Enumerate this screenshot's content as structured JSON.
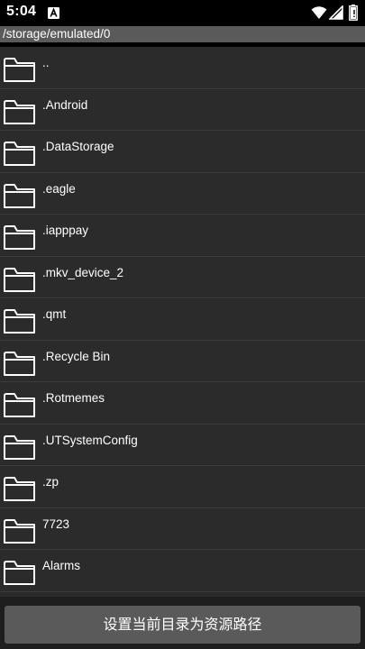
{
  "status_bar": {
    "time": "5:04",
    "notification_icon": "a-letter-icon",
    "wifi_icon": "wifi-icon",
    "signal_icon": "signal-icon",
    "battery_icon": "battery-icon"
  },
  "path_bar": {
    "path": "/storage/emulated/0"
  },
  "file_list": {
    "items": [
      {
        "name": "..",
        "icon": "folder-icon"
      },
      {
        "name": ".Android",
        "icon": "folder-icon"
      },
      {
        "name": ".DataStorage",
        "icon": "folder-icon"
      },
      {
        "name": ".eagle",
        "icon": "folder-icon"
      },
      {
        "name": ".iapppay",
        "icon": "folder-icon"
      },
      {
        "name": ".mkv_device_2",
        "icon": "folder-icon"
      },
      {
        "name": ".qmt",
        "icon": "folder-icon"
      },
      {
        "name": ".Recycle Bin",
        "icon": "folder-icon"
      },
      {
        "name": ".Rotmemes",
        "icon": "folder-icon"
      },
      {
        "name": ".UTSystemConfig",
        "icon": "folder-icon"
      },
      {
        "name": ".zp",
        "icon": "folder-icon"
      },
      {
        "name": "7723",
        "icon": "folder-icon"
      },
      {
        "name": "Alarms",
        "icon": "folder-icon"
      }
    ]
  },
  "action": {
    "set_path_label": "设置当前目录为资源路径"
  },
  "colors": {
    "status_bar_bg": "#000000",
    "path_bar_bg": "#5a5a5a",
    "list_bg": "#2b2b2b",
    "divider": "#3c3c3c",
    "button_bg": "#5a5a5a",
    "text": "#ffffff"
  }
}
